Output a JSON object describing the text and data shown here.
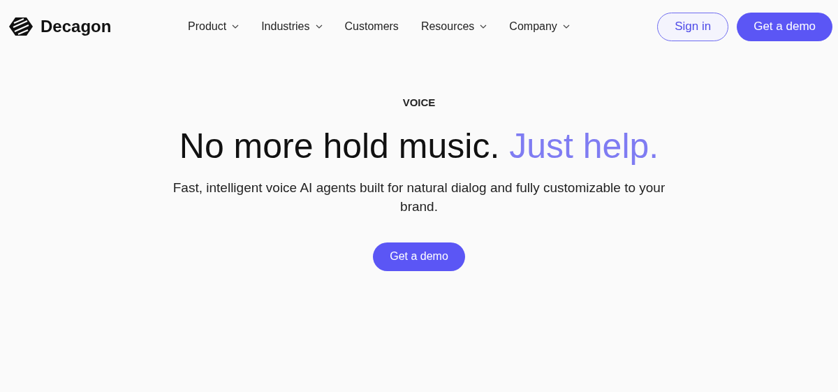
{
  "header": {
    "logo": "Decagon",
    "nav": [
      {
        "label": "Product",
        "kind": "dropdown"
      },
      {
        "label": "Industries",
        "kind": "dropdown"
      },
      {
        "label": "Customers",
        "kind": "link"
      },
      {
        "label": "Resources",
        "kind": "dropdown"
      },
      {
        "label": "Company",
        "kind": "dropdown"
      }
    ],
    "sign_in": "Sign in",
    "demo": "Get a demo"
  },
  "hero": {
    "eyebrow": "VOICE",
    "title": "No more hold music.",
    "title_accent": "Just help.",
    "subtitle": "Fast, intelligent voice AI agents built for natural dialog and fully customizable to your brand.",
    "cta": "Get a demo"
  }
}
